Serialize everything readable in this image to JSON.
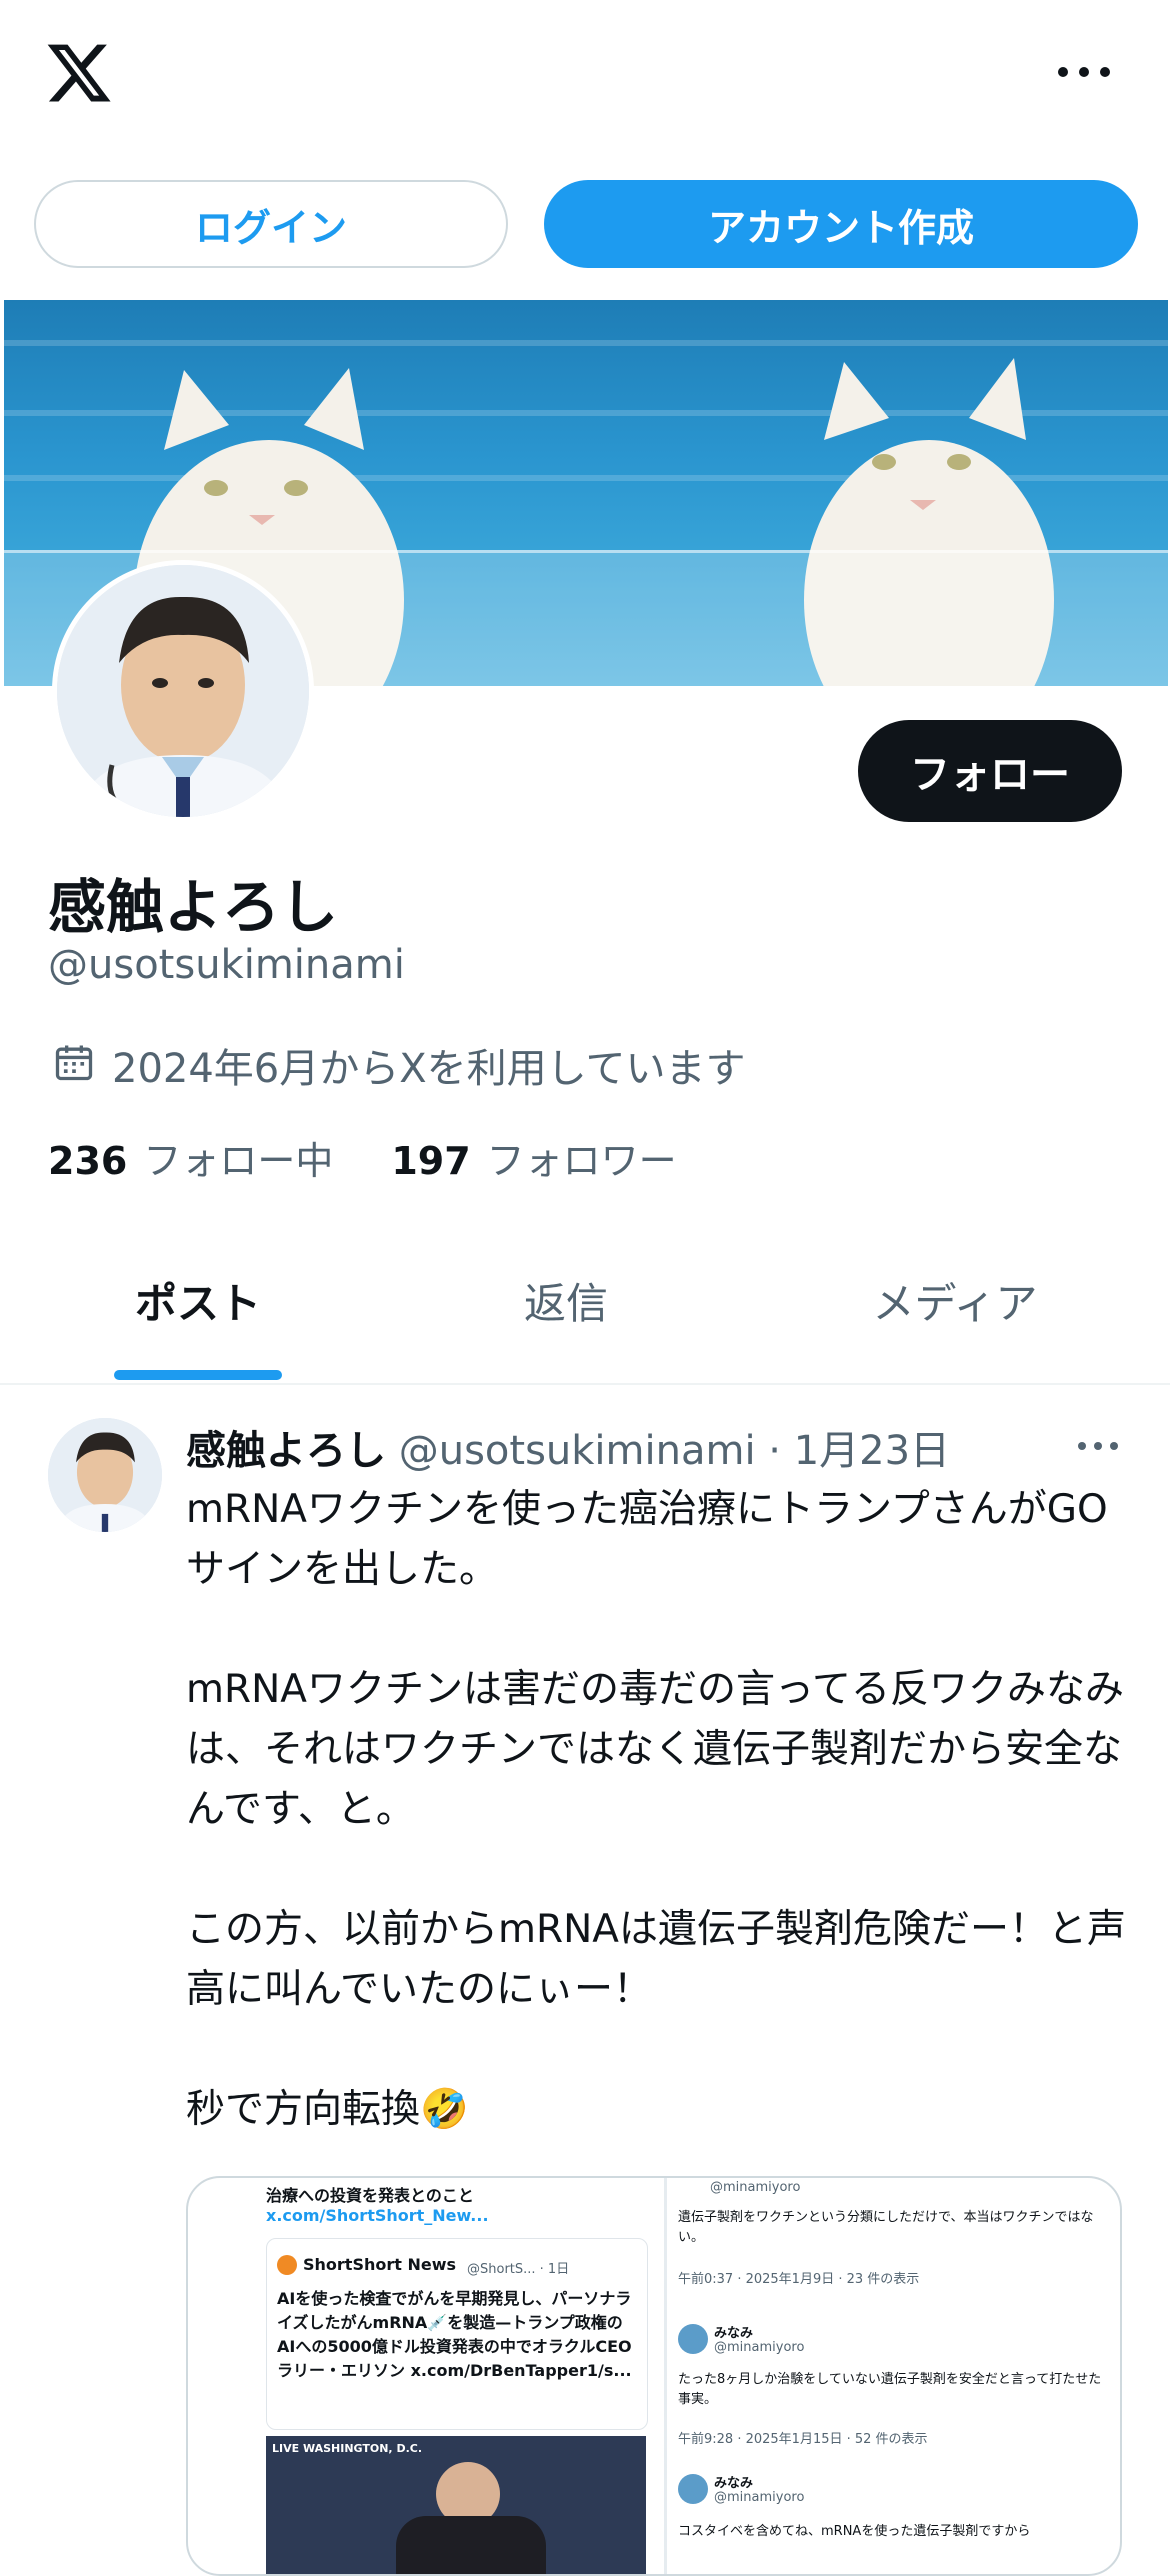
{
  "header": {
    "logo": "x-logo-icon",
    "more_icon": "more-horizontal-icon",
    "login_label": "ログイン",
    "signup_label": "アカウント作成"
  },
  "profile": {
    "display_name": "感触よろし",
    "handle": "@usotsukiminami",
    "joined": "2024年6月からXを利用しています",
    "following_count": "236",
    "following_label": "フォロー中",
    "followers_count": "197",
    "followers_label": "フォロワー",
    "follow_label": "フォロー"
  },
  "tabs": [
    {
      "label": "ポスト",
      "active": true
    },
    {
      "label": "返信",
      "active": false
    },
    {
      "label": "メディア",
      "active": false
    }
  ],
  "post": {
    "name": "感触よろし",
    "meta": "@usotsukiminami · 1月23日",
    "text": "mRNAワクチンを使った癌治療にトランプさんがGOサインを出した。\n\nmRNAワクチンは害だの毒だの言ってる反ワクみなみは、それはワクチンではなく遺伝子製剤だから安全なんです、と。\n\nこの方、以前からmRNAは遺伝子製剤危険だー！と声高に叫んでいたのにぃー！\n\n秒で方向転換🤣",
    "media": {
      "left": {
        "line1": "治療への投資を発表とのこと",
        "link": "x.com/ShortShort_New...",
        "quote_name": "ShortShort News",
        "quote_meta": "@ShortS... · 1日",
        "quote_text": "AIを使った検査でがんを早期発見し、パーソナライズしたがんmRNA💉を製造—トランプ政権のAIへの5000億ドル投資発表の中でオラクルCEOラリー・エリソン x.com/DrBenTapper1/s...",
        "video_tag": "LIVE WASHINGTON, D.C."
      },
      "right": {
        "handle1": "@minamiyoro",
        "text1": "遺伝子製剤をワクチンという分類にしただけで、本当はワクチンではない。",
        "meta1": "午前0:37 · 2025年1月9日 · 23 件の表示",
        "name2": "みなみ",
        "handle2": "@minamiyoro",
        "text2": "たった8ヶ月しか治験をしていない遺伝子製剤を安全だと言って打たせた事実。",
        "meta2": "午前9:28 · 2025年1月15日 · 52 件の表示",
        "name3": "みなみ",
        "handle3": "@minamiyoro",
        "text3": "コスタイベを含めてね、mRNAを使った遺伝子製剤ですから"
      }
    }
  },
  "icons": {
    "calendar": "calendar-icon",
    "post_more": "more-horizontal-icon"
  },
  "colors": {
    "accent": "#1d9bf0",
    "text": "#0f1419",
    "secondary": "#536471"
  }
}
